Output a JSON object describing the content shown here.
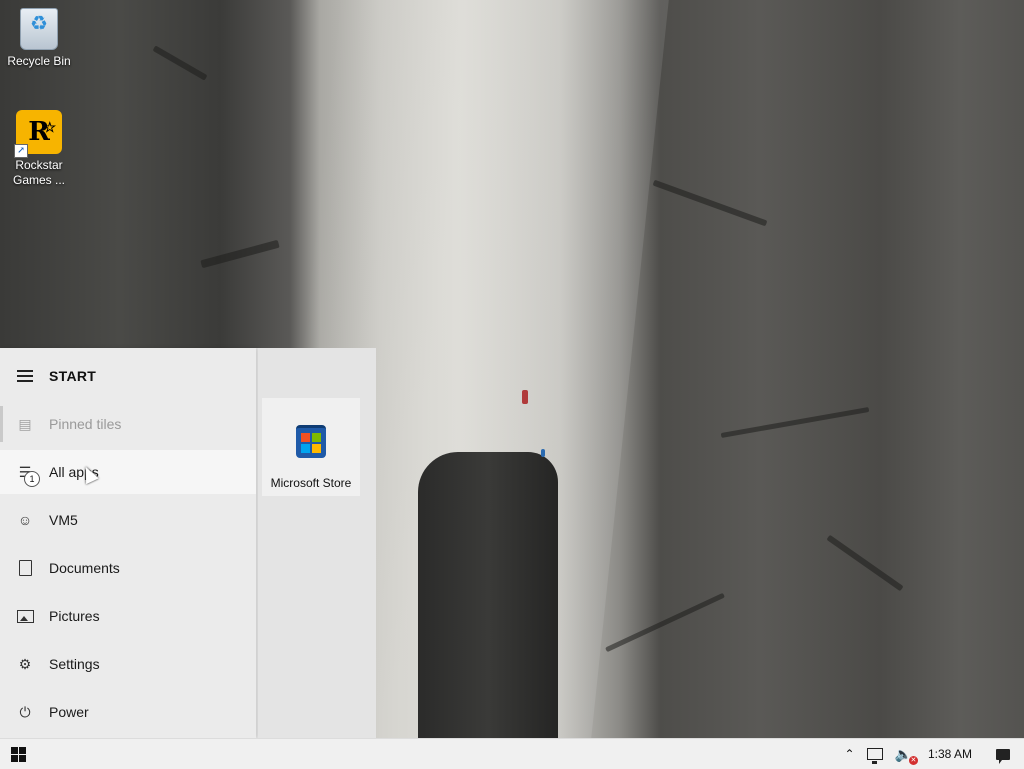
{
  "desktop": {
    "icons": [
      {
        "label": "Recycle Bin",
        "icon": "recycle-bin-icon"
      },
      {
        "label": "Rockstar Games ...",
        "icon": "rockstar-games-icon",
        "glyph": "R"
      }
    ]
  },
  "start_menu": {
    "title": "START",
    "items": [
      {
        "label": "Pinned tiles",
        "icon": "pinned-tiles-icon",
        "state": "disabled"
      },
      {
        "label": "All apps",
        "icon": "all-apps-icon",
        "badge": "1",
        "state": "hover"
      },
      {
        "label": "VM5",
        "icon": "user-icon"
      },
      {
        "label": "Documents",
        "icon": "document-icon"
      },
      {
        "label": "Pictures",
        "icon": "pictures-icon"
      },
      {
        "label": "Settings",
        "icon": "gear-icon"
      },
      {
        "label": "Power",
        "icon": "power-icon"
      }
    ],
    "tiles": [
      {
        "label": "Microsoft Store",
        "icon": "microsoft-store-icon"
      }
    ]
  },
  "taskbar": {
    "start_icon": "windows-logo-icon",
    "tray": {
      "chevron_icon": "chevron-up-icon",
      "network_icon": "network-icon",
      "volume_icon": "volume-muted-icon",
      "time": "1:38 AM",
      "notification_icon": "action-center-icon"
    }
  },
  "colors": {
    "store_red": "#f25022",
    "store_green": "#7fba00",
    "store_blue": "#00a4ef",
    "store_yellow": "#ffb900",
    "rockstar_yellow": "#f7b400"
  }
}
